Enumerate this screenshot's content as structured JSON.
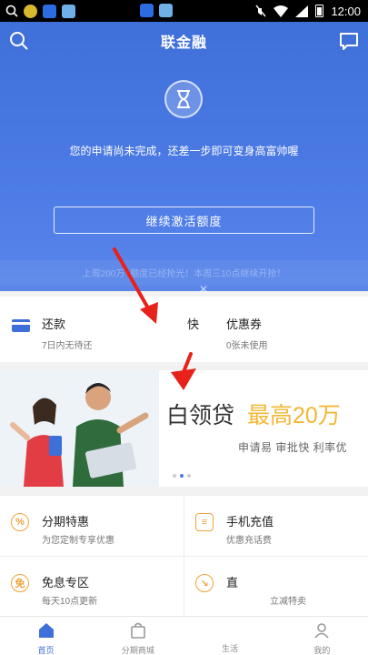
{
  "status_bar": {
    "time": "12:00"
  },
  "header": {
    "brand": "联金融"
  },
  "hero": {
    "message": "您的申请尚未完成，还差一步即可变身高富帅喔",
    "activate_button": "继续激活额度",
    "notice": "上周200万+额度已经抢光！本周三10点继续开抢！"
  },
  "repay": {
    "title": "还款",
    "subtitle": "7日内无待还"
  },
  "coupon": {
    "prefix": "快",
    "title": "优惠券",
    "subtitle": "0张未使用"
  },
  "banner": {
    "title": "白领贷",
    "amount": "最高20万",
    "subtitle": "申请易  审批快  利率优"
  },
  "grid": [
    {
      "title": "分期特惠",
      "subtitle": "为您定制专享优惠",
      "icon": "percent-icon"
    },
    {
      "title": "手机充值",
      "subtitle": "优惠充话费",
      "icon": "recharge-icon"
    },
    {
      "title": "免息专区",
      "subtitle": "每天10点更新",
      "icon": "free-icon"
    },
    {
      "title": "直",
      "subtitle": "立减特卖",
      "icon": "sale-icon"
    }
  ],
  "nav": [
    {
      "label": "首页"
    },
    {
      "label": "分期商城"
    },
    {
      "label": "生活"
    },
    {
      "label": "我的"
    }
  ],
  "colors": {
    "primary": "#4c7be6",
    "accent": "#f1b733",
    "icon_orange": "#f1a23a",
    "arrow": "#e8211b"
  }
}
